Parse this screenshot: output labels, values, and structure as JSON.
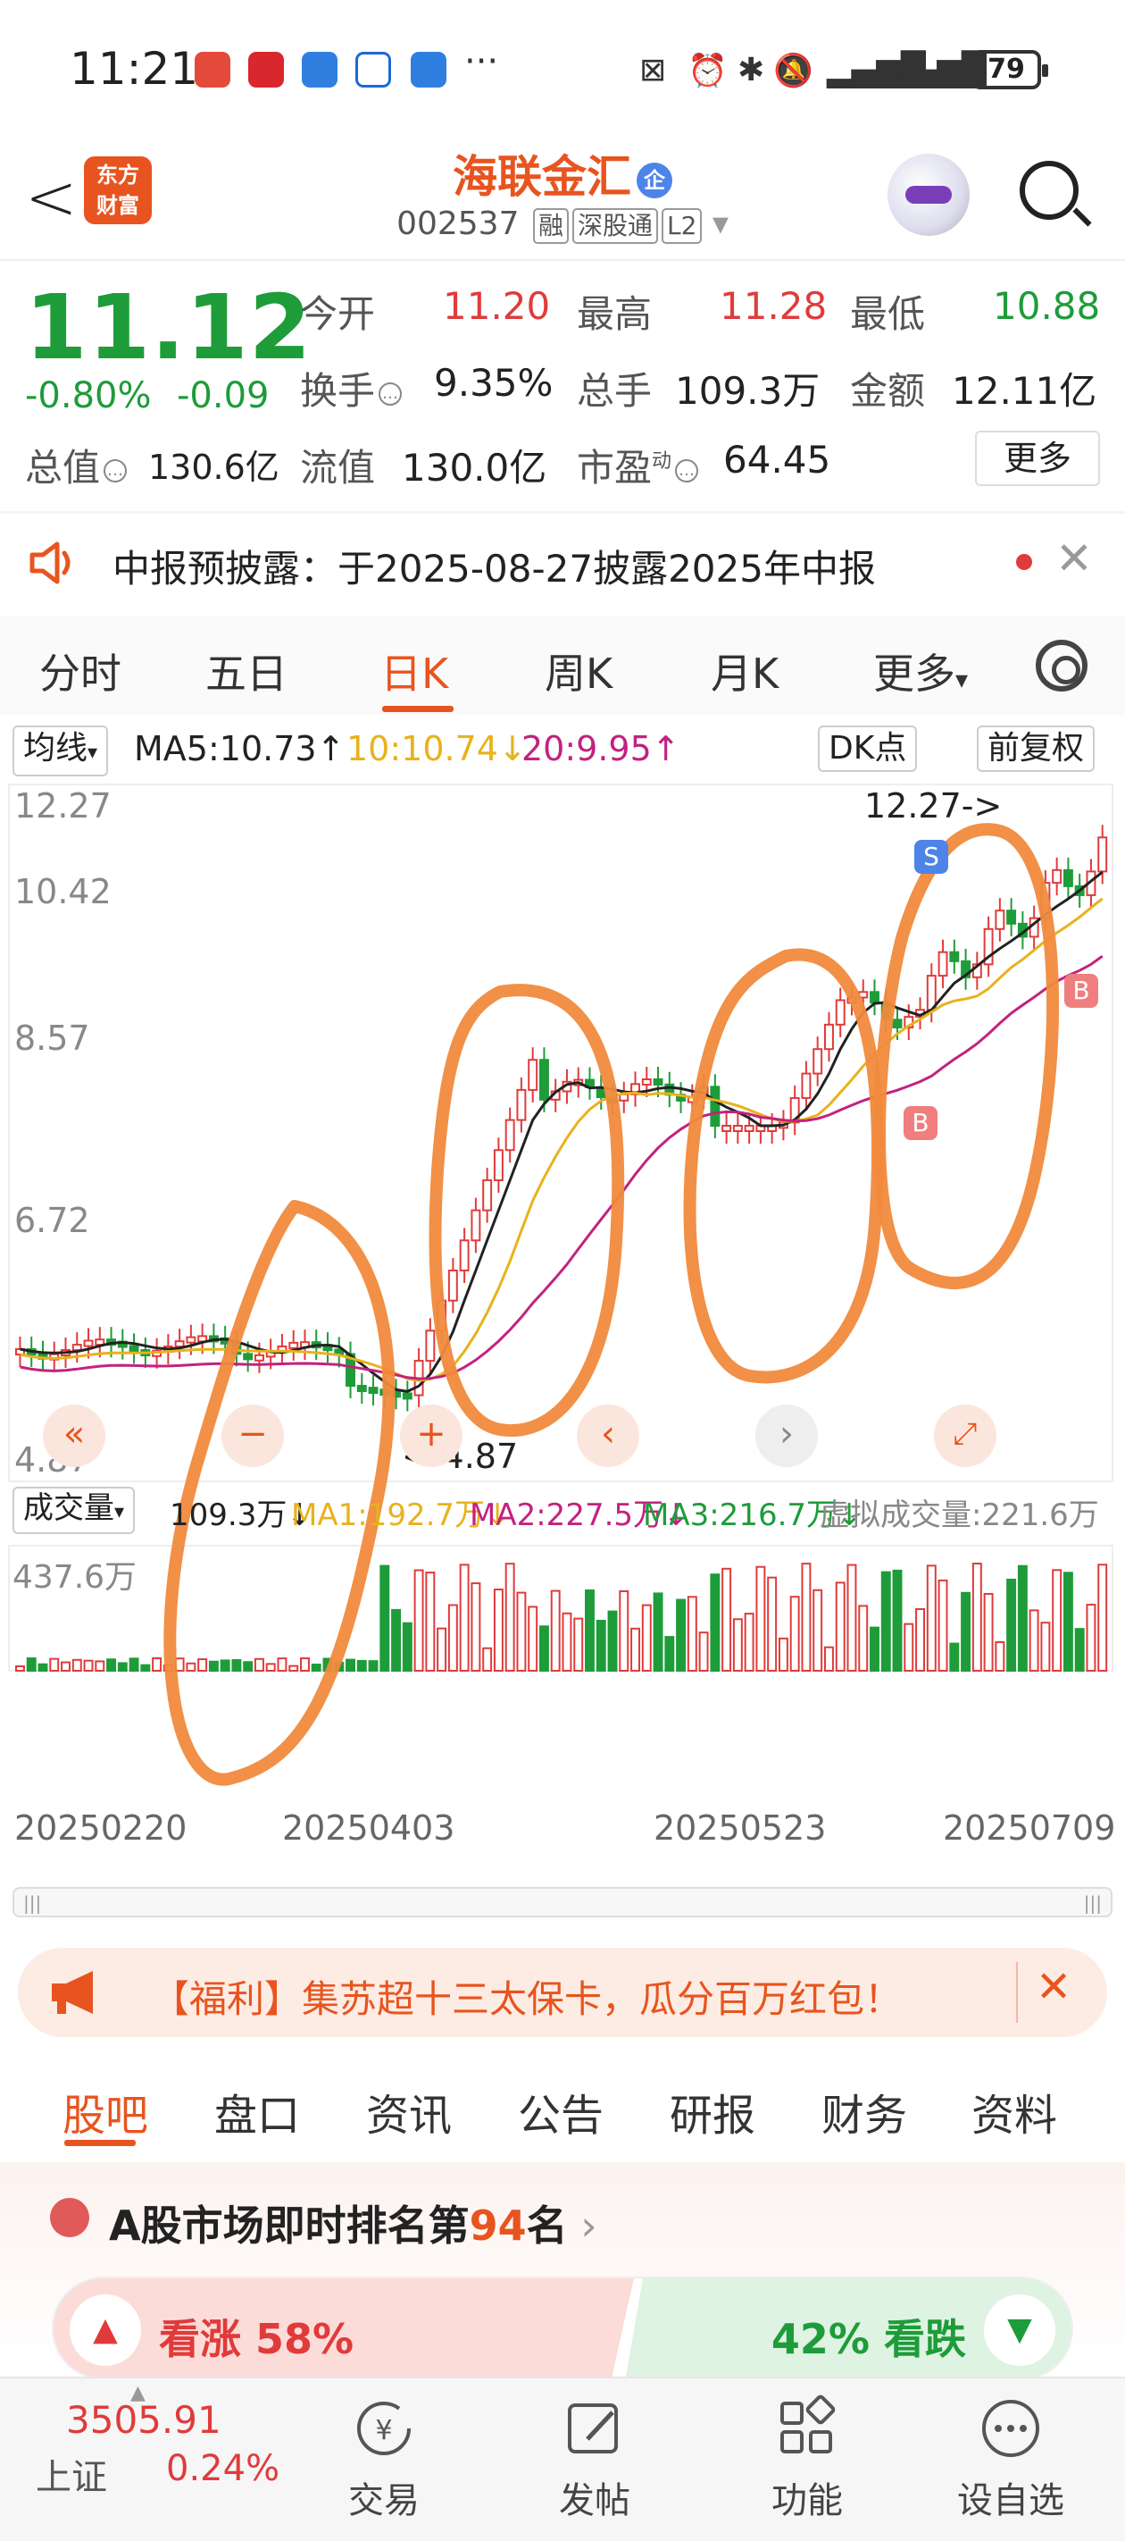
{
  "status_bar": {
    "time": "11:21",
    "battery": "79",
    "more_dots": "···"
  },
  "header": {
    "back": "<",
    "logo_line1": "东方",
    "logo_line2": "财富",
    "stock_name": "海联金汇",
    "badge": "企",
    "code": "002537",
    "tags": [
      "融",
      "深股通",
      "L2"
    ]
  },
  "quote": {
    "price": "11.12",
    "change_pct": "-0.80%",
    "change": "-0.09",
    "fields": [
      {
        "label": "今开",
        "value": "11.20"
      },
      {
        "label": "最高",
        "value": "11.28"
      },
      {
        "label": "最低",
        "value": "10.88"
      },
      {
        "label": "换手",
        "value": "9.35%"
      },
      {
        "label": "总手",
        "value": "109.3万"
      },
      {
        "label": "金额",
        "value": "12.11亿"
      },
      {
        "label": "总值",
        "value": "130.6亿"
      },
      {
        "label": "流值",
        "value": "130.0亿"
      },
      {
        "label": "市盈",
        "sup": "动",
        "value": "64.45"
      }
    ],
    "more_button": "更多"
  },
  "notice": {
    "text": "中报预披露：于2025-08-27披露2025年中报"
  },
  "period_tabs": [
    "分时",
    "五日",
    "日K",
    "周K",
    "月K",
    "更多"
  ],
  "chart": {
    "ma_selector": "均线",
    "ma5": "MA5:10.73↑",
    "ma10": "10:10.74↓",
    "ma20": "20:9.95↑",
    "dk_button": "DK点",
    "adjust_button": "前复权",
    "price_axis": [
      "12.27",
      "10.42",
      "8.57",
      "6.72",
      "4.87"
    ],
    "high_marker": "12.27->",
    "low_marker": "<-4.87",
    "vol_selector": "成交量",
    "vol_value": "109.3万↓",
    "vol_ma1": "MA1:192.7万↓",
    "vol_ma2": "MA2:227.5万↓",
    "vol_ma3": "MA3:216.7万↓",
    "vol_virtual": "虚拟成交量:221.6万",
    "vol_axis_max": "437.6万",
    "dates": [
      "20250220",
      "20250403",
      "20250523",
      "20250709"
    ],
    "s_marker": "S",
    "b_marker": "B",
    "colors": {
      "ma5": "#222222",
      "ma10": "#e8b21c",
      "ma20": "#c2227f",
      "up": "#e03b3b",
      "down": "#1e9c3a"
    }
  },
  "banner": {
    "text": "【福利】集苏超十三太保卡，瓜分百万红包！"
  },
  "bottom_tabs": [
    "股吧",
    "盘口",
    "资讯",
    "公告",
    "研报",
    "财务",
    "资料"
  ],
  "ranking": {
    "prefix": "A股市场即时排名第",
    "rank": "94",
    "suffix": "名",
    "bull": "看涨 58%",
    "bear": "42% 看跌"
  },
  "index": {
    "value": "3505.91",
    "name": "上证",
    "pct": "0.24%"
  },
  "nav": [
    {
      "icon": "exchange-icon",
      "label": "交易"
    },
    {
      "icon": "post-icon",
      "label": "发帖"
    },
    {
      "icon": "grid-icon",
      "label": "功能"
    },
    {
      "icon": "more-icon",
      "label": "设自选"
    }
  ]
}
